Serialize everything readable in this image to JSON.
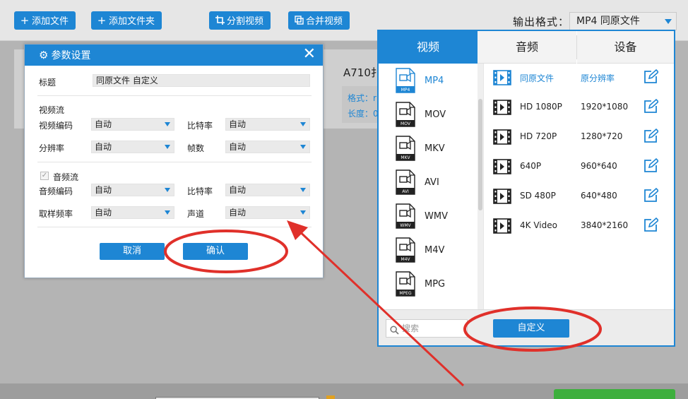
{
  "toolbar": {
    "add_file": "添加文件",
    "add_folder": "添加文件夹",
    "split_video": "分割视频",
    "merge_video": "合并视频",
    "output_format_label": "输出格式：",
    "output_format_value": "MP4   同原文件"
  },
  "file": {
    "name": "A710扌",
    "format_label": "格式：r",
    "duration_label": "长度：0"
  },
  "dialog": {
    "title": "参数设置",
    "close": "✕",
    "title_label": "标题",
    "title_value": "同原文件 自定义",
    "video_section": "视频流",
    "video_codec_label": "视频编码",
    "video_codec_value": "自动",
    "video_bitrate_label": "比特率",
    "video_bitrate_value": "自动",
    "resolution_label": "分辨率",
    "resolution_value": "自动",
    "framerate_label": "帧数",
    "framerate_value": "自动",
    "audio_section": "音频流",
    "audio_checked": true,
    "audio_codec_label": "音频编码",
    "audio_codec_value": "自动",
    "audio_bitrate_label": "比特率",
    "audio_bitrate_value": "自动",
    "samplerate_label": "取样频率",
    "samplerate_value": "自动",
    "channel_label": "声道",
    "channel_value": "自动",
    "cancel": "取消",
    "confirm": "确认"
  },
  "panel": {
    "tabs": [
      "视频",
      "音频",
      "设备"
    ],
    "active_tab": 0,
    "formats": [
      {
        "label": "MP4",
        "icon_text": "MP4",
        "selected": true
      },
      {
        "label": "MOV",
        "icon_text": "MOV",
        "selected": false
      },
      {
        "label": "MKV",
        "icon_text": "MKV",
        "selected": false
      },
      {
        "label": "AVI",
        "icon_text": "AVI",
        "selected": false
      },
      {
        "label": "WMV",
        "icon_text": "WMV",
        "selected": false
      },
      {
        "label": "M4V",
        "icon_text": "M4V",
        "selected": false
      },
      {
        "label": "MPG",
        "icon_text": "MPEG",
        "selected": false
      }
    ],
    "presets": [
      {
        "name": "同原文件",
        "resolution": "原分辨率",
        "selected": true
      },
      {
        "name": "HD 1080P",
        "resolution": "1920*1080",
        "selected": false
      },
      {
        "name": "HD 720P",
        "resolution": "1280*720",
        "selected": false
      },
      {
        "name": "640P",
        "resolution": "960*640",
        "selected": false
      },
      {
        "name": "SD 480P",
        "resolution": "640*480",
        "selected": false
      },
      {
        "name": "4K Video",
        "resolution": "3840*2160",
        "selected": false
      }
    ],
    "search_placeholder": "搜索",
    "custom_button": "自定义"
  },
  "colors": {
    "accent": "#1e86d4",
    "annotation": "#e0302a"
  }
}
